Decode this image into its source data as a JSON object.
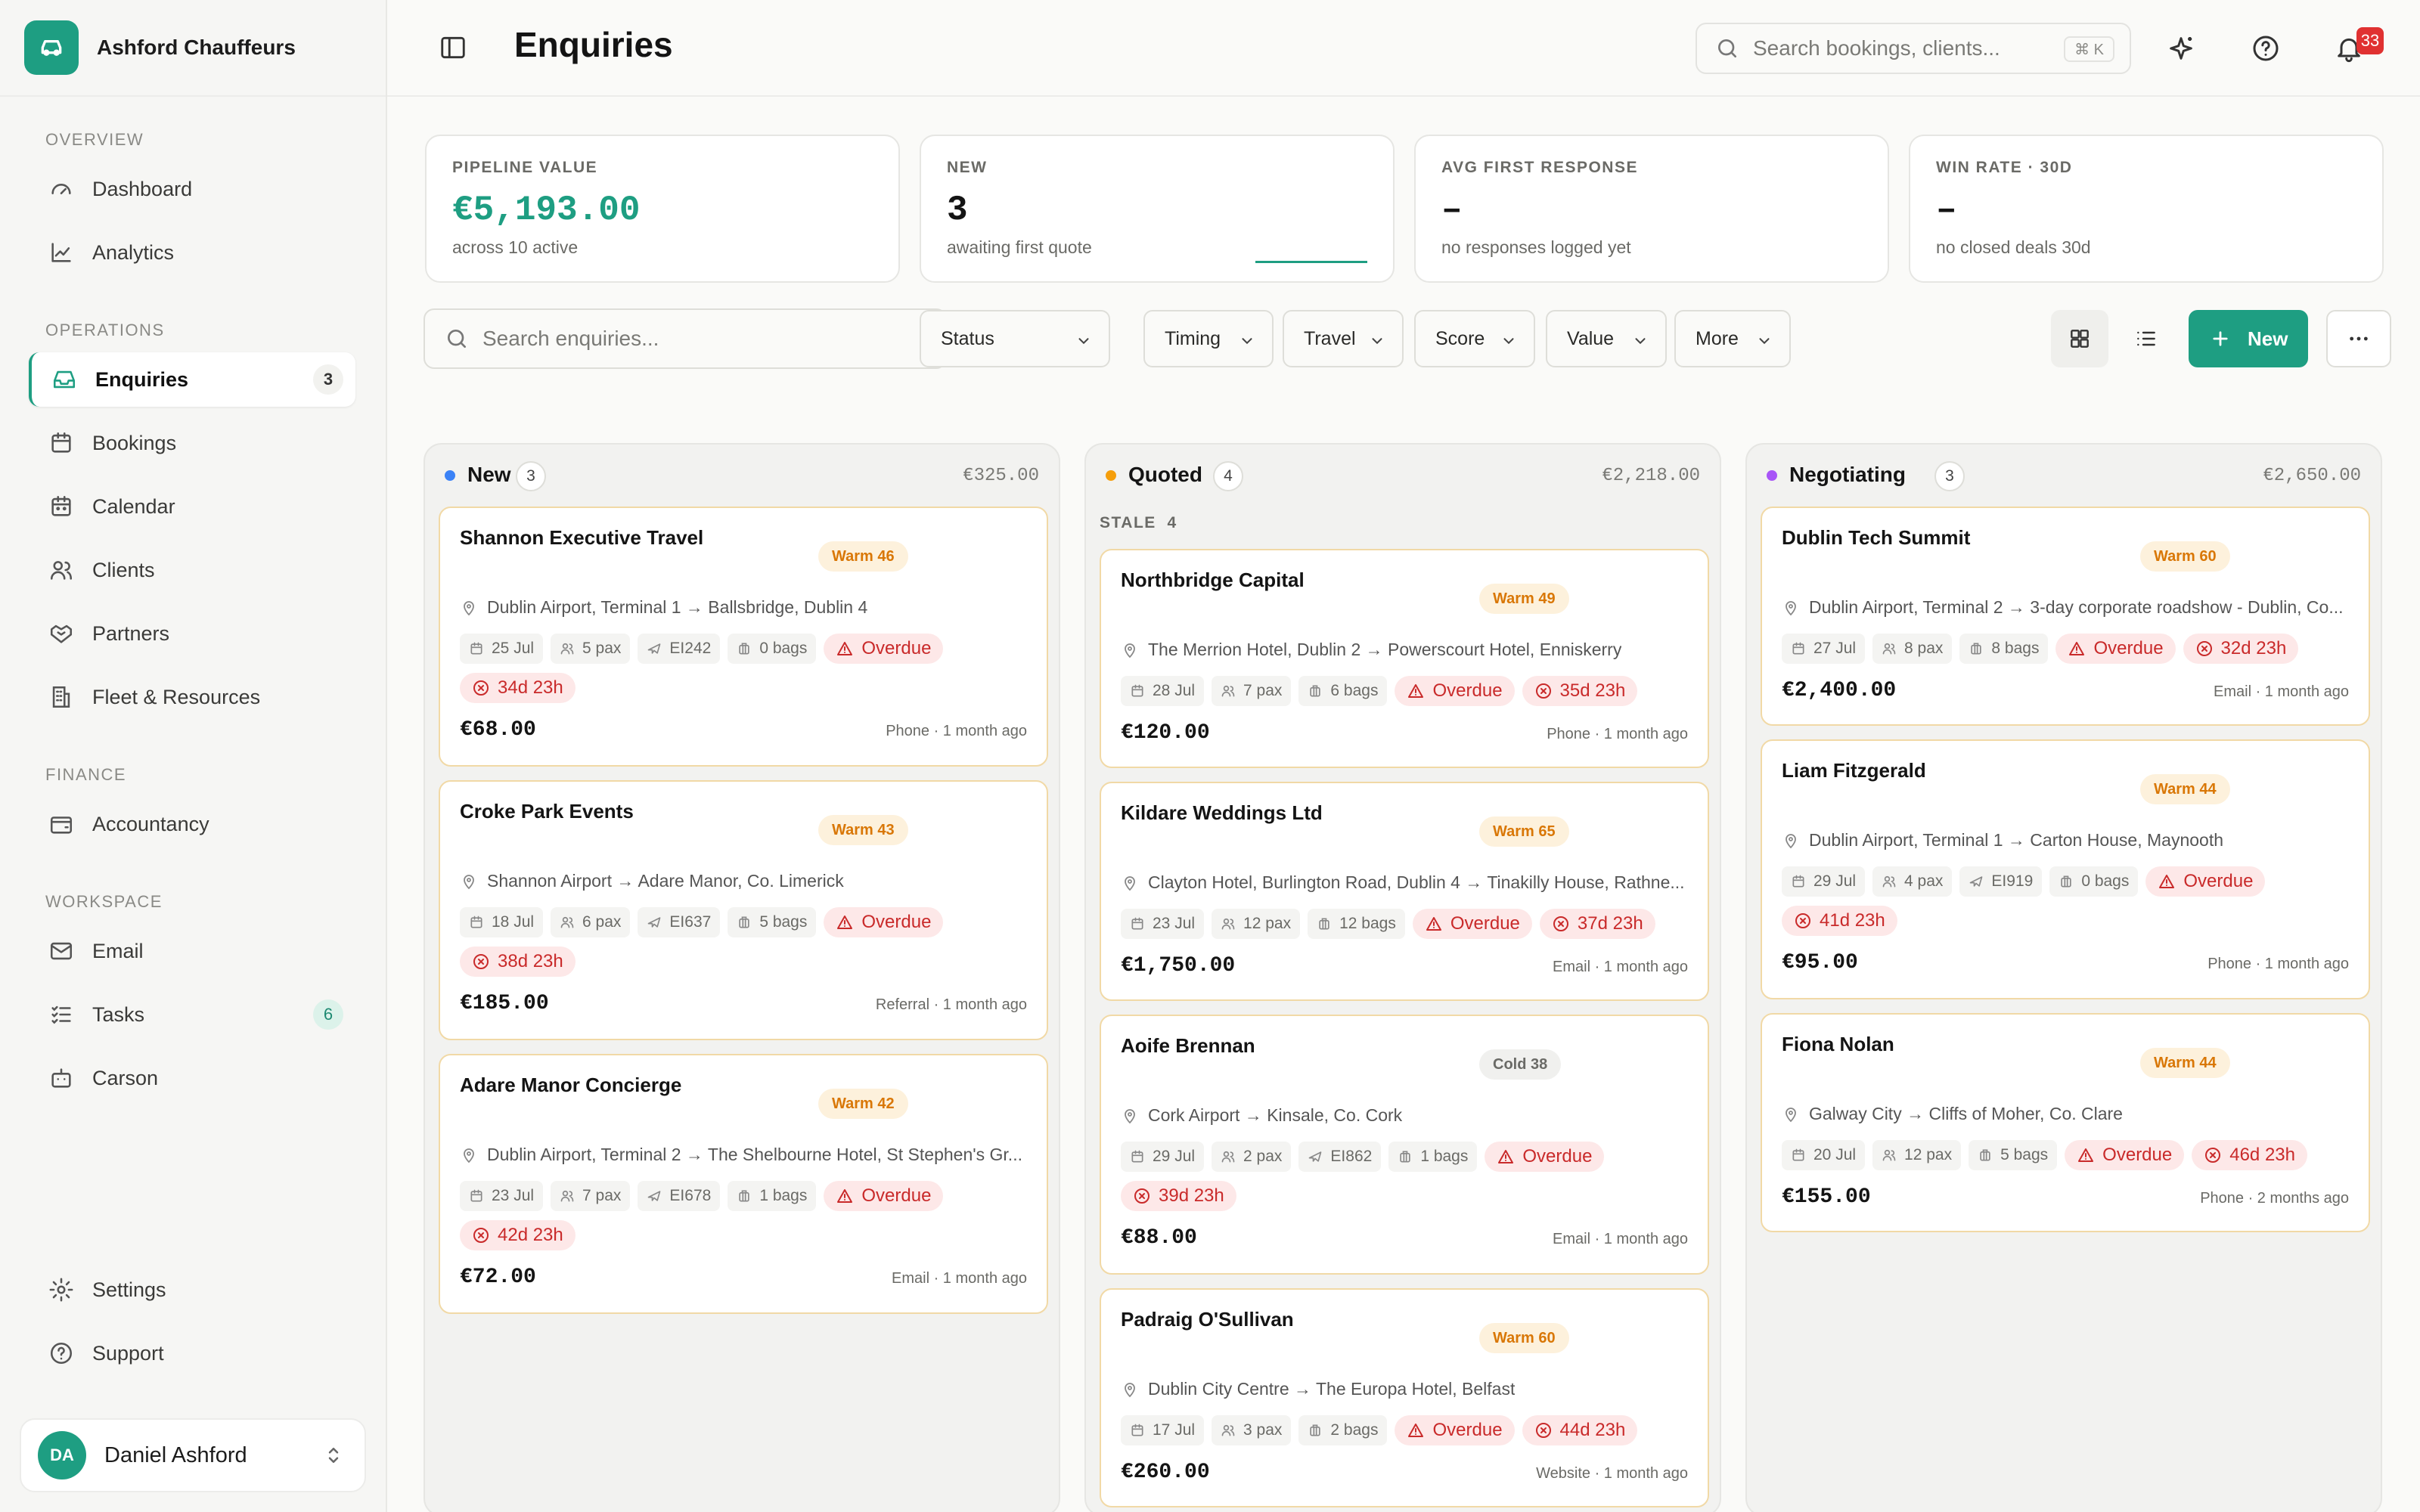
{
  "brand": {
    "name": "Ashford Chauffeurs"
  },
  "sidebar": {
    "sections": {
      "overview": "OVERVIEW",
      "operations": "OPERATIONS",
      "finance": "FINANCE",
      "workspace": "WORKSPACE"
    },
    "items": [
      {
        "label": "Dashboard"
      },
      {
        "label": "Analytics"
      },
      {
        "label": "Enquiries",
        "badge": "3"
      },
      {
        "label": "Bookings"
      },
      {
        "label": "Calendar"
      },
      {
        "label": "Clients"
      },
      {
        "label": "Partners"
      },
      {
        "label": "Fleet & Resources"
      },
      {
        "label": "Accountancy"
      },
      {
        "label": "Email"
      },
      {
        "label": "Tasks",
        "badge": "6"
      },
      {
        "label": "Carson"
      },
      {
        "label": "Settings"
      },
      {
        "label": "Support"
      }
    ],
    "user": {
      "initials": "DA",
      "name": "Daniel Ashford"
    }
  },
  "header": {
    "title": "Enquiries",
    "search_placeholder": "Search bookings, clients...",
    "shortcut": "⌘ K",
    "notifications": "33"
  },
  "stats": [
    {
      "label": "PIPELINE VALUE",
      "value": "€5,193.00",
      "sub": "across 10 active"
    },
    {
      "label": "NEW",
      "value": "3",
      "sub": "awaiting first quote"
    },
    {
      "label": "AVG FIRST RESPONSE",
      "value": "–",
      "sub": "no responses logged yet"
    },
    {
      "label": "WIN RATE · 30D",
      "value": "–",
      "sub": "no closed deals 30d"
    }
  ],
  "filters": {
    "search_placeholder": "Search enquiries...",
    "items": [
      "Status",
      "Timing",
      "Travel",
      "Score",
      "Value",
      "More"
    ],
    "new_label": "New"
  },
  "columns": [
    {
      "title": "New",
      "count": "3",
      "total": "€325.00",
      "dot": "#3b82f6",
      "cards": [
        {
          "name": "Shannon Executive Travel",
          "score": "Warm 46",
          "route": "Dublin Airport, Terminal 1 → Ballsbridge, Dublin 4",
          "date": "25 Jul",
          "pax": "5 pax",
          "flight": "EI242",
          "bags": "0 bags",
          "overdue": "Overdue",
          "age": "34d 23h",
          "price": "€68.00",
          "meta": "Phone · 1 month ago"
        },
        {
          "name": "Croke Park Events",
          "score": "Warm 43",
          "route": "Shannon Airport → Adare Manor, Co. Limerick",
          "date": "18 Jul",
          "pax": "6 pax",
          "flight": "EI637",
          "bags": "5 bags",
          "overdue": "Overdue",
          "age": "38d 23h",
          "price": "€185.00",
          "meta": "Referral · 1 month ago"
        },
        {
          "name": "Adare Manor Concierge",
          "score": "Warm 42",
          "route": "Dublin Airport, Terminal 2 → The Shelbourne Hotel, St Stephen's Gr...",
          "date": "23 Jul",
          "pax": "7 pax",
          "flight": "EI678",
          "bags": "1 bags",
          "overdue": "Overdue",
          "age": "42d 23h",
          "price": "€72.00",
          "meta": "Email · 1 month ago"
        }
      ]
    },
    {
      "title": "Quoted",
      "count": "4",
      "total": "€2,218.00",
      "dot": "#f59e0b",
      "stale": "STALE",
      "cards": [
        {
          "name": "Northbridge Capital",
          "score": "Warm 49",
          "route": "The Merrion Hotel, Dublin 2 → Powerscourt Hotel, Enniskerry",
          "date": "28 Jul",
          "pax": "7 pax",
          "bags": "6 bags",
          "overdue": "Overdue",
          "age": "35d 23h",
          "price": "€120.00",
          "meta": "Phone · 1 month ago"
        },
        {
          "name": "Kildare Weddings Ltd",
          "score": "Warm 65",
          "route": "Clayton Hotel, Burlington Road, Dublin 4 → Tinakilly House, Rathne...",
          "date": "23 Jul",
          "pax": "12 pax",
          "bags": "12 bags",
          "overdue": "Overdue",
          "age": "37d 23h",
          "price": "€1,750.00",
          "meta": "Email · 1 month ago"
        },
        {
          "name": "Aoife Brennan",
          "score": "Cold 38",
          "route": "Cork Airport → Kinsale, Co. Cork",
          "date": "29 Jul",
          "pax": "2 pax",
          "flight": "EI862",
          "bags": "1 bags",
          "overdue": "Overdue",
          "age": "39d 23h",
          "price": "€88.00",
          "meta": "Email · 1 month ago"
        },
        {
          "name": "Padraig O'Sullivan",
          "score": "Warm 60",
          "route": "Dublin City Centre → The Europa Hotel, Belfast",
          "date": "17 Jul",
          "pax": "3 pax",
          "bags": "2 bags",
          "overdue": "Overdue",
          "age": "44d 23h",
          "price": "€260.00",
          "meta": "Website · 1 month ago"
        }
      ]
    },
    {
      "title": "Negotiating",
      "count": "3",
      "total": "€2,650.00",
      "dot": "#a855f7",
      "cards": [
        {
          "name": "Dublin Tech Summit",
          "score": "Warm 60",
          "route": "Dublin Airport, Terminal 2 → 3-day corporate roadshow - Dublin, Co...",
          "date": "27 Jul",
          "pax": "8 pax",
          "bags": "8 bags",
          "overdue": "Overdue",
          "age": "32d 23h",
          "price": "€2,400.00",
          "meta": "Email · 1 month ago"
        },
        {
          "name": "Liam Fitzgerald",
          "score": "Warm 44",
          "route": "Dublin Airport, Terminal 1 → Carton House, Maynooth",
          "date": "29 Jul",
          "pax": "4 pax",
          "flight": "EI919",
          "bags": "0 bags",
          "overdue": "Overdue",
          "age": "41d 23h",
          "price": "€95.00",
          "meta": "Phone · 1 month ago"
        },
        {
          "name": "Fiona Nolan",
          "score": "Warm 44",
          "route": "Galway City → Cliffs of Moher, Co. Clare",
          "date": "20 Jul",
          "pax": "12 pax",
          "bags": "5 bags",
          "overdue": "Overdue",
          "age": "46d 23h",
          "price": "€155.00",
          "meta": "Phone · 2 months ago"
        }
      ]
    }
  ]
}
